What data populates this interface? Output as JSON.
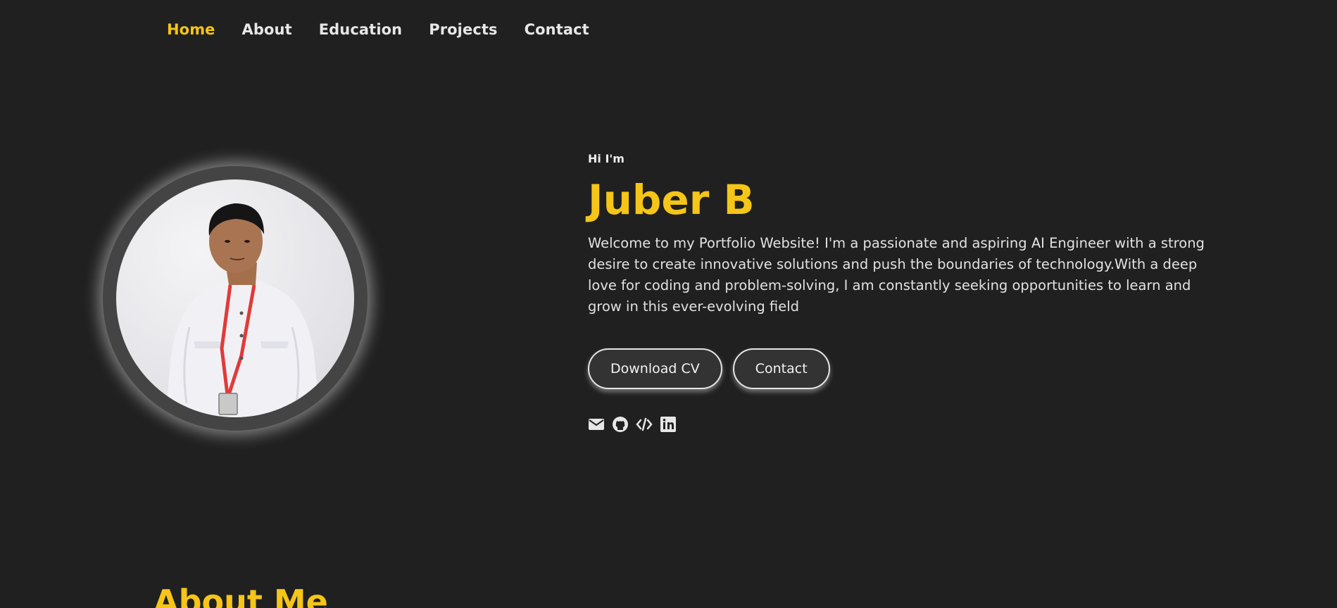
{
  "nav": {
    "items": [
      {
        "label": "Home",
        "active": true
      },
      {
        "label": "About",
        "active": false
      },
      {
        "label": "Education",
        "active": false
      },
      {
        "label": "Projects",
        "active": false
      },
      {
        "label": "Contact",
        "active": false
      }
    ]
  },
  "hero": {
    "greeting": "Hi I'm",
    "name": "Juber B",
    "intro": "Welcome to my Portfolio Website! I'm a passionate and aspiring AI Engineer with a strong desire to create innovative solutions and push the boundaries of technology.With a deep love for coding and problem-solving, I am constantly seeking opportunities to learn and grow in this ever-evolving field",
    "buttons": {
      "download_cv": "Download CV",
      "contact": "Contact"
    },
    "socials": [
      "envelope-icon",
      "github-icon",
      "code-icon",
      "linkedin-icon"
    ]
  },
  "about": {
    "heading": "About Me"
  },
  "colors": {
    "background": "#202020",
    "accent": "#f5c518",
    "text": "#e2e2e2",
    "button_bg": "#333333"
  }
}
